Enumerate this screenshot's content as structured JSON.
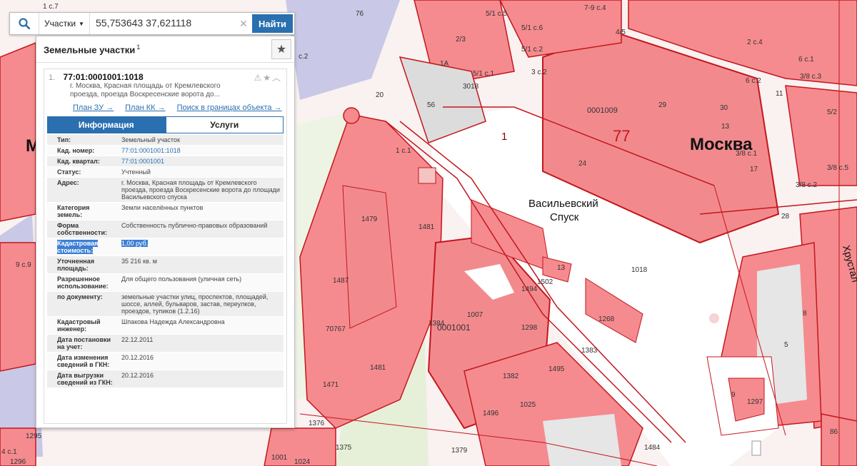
{
  "search": {
    "type_label": "Участки",
    "query": "55,753643 37,621118",
    "find_label": "Найти"
  },
  "panel": {
    "title": "Земельные участки",
    "title_count": "1",
    "result": {
      "index": "1.",
      "cadastral_id": "77:01:0001001:1018",
      "address": "г. Москва, Красная площадь от Кремлевского проезда, проезда Воскресенские ворота до...",
      "links": [
        "План ЗУ →",
        "План КК →",
        "Поиск в границах объекта →"
      ],
      "tabs": [
        "Информация",
        "Услуги"
      ],
      "rows": [
        {
          "label": "Тип:",
          "value": "Земельный участок"
        },
        {
          "label": "Кад. номер:",
          "value": "77:01:0001001:1018"
        },
        {
          "label": "Кад. квартал:",
          "value": "77:01:0001001"
        },
        {
          "label": "Статус:",
          "value": "Учтенный"
        },
        {
          "label": "Адрес:",
          "value": "г. Москва, Красная площадь от Кремлевского проезда, проезда Воскресенские ворота до площади Васильевского спуска"
        },
        {
          "label": "Категория земель:",
          "value": "Земли населённых пунктов"
        },
        {
          "label": "Форма собственности:",
          "value": "Собственность публично-правовых образований"
        },
        {
          "label": "Кадастровая стоимость:",
          "value": "1,00 руб."
        },
        {
          "label": "Уточненная площадь:",
          "value": "35 216 кв. м"
        },
        {
          "label": "Разрешенное использование:",
          "value": "Для общего пользования (уличная сеть)"
        },
        {
          "label": "по документу:",
          "value": "земельные участки улиц, проспектов, площадей, шоссе, аллей, бульваров, застав, переулков, проездов, тупиков (1.2.16)"
        },
        {
          "label": "Кадастровый инженер:",
          "value": "Шпакова Надежда Александровна"
        },
        {
          "label": "Дата постановки на учет:",
          "value": "22.12.2011"
        },
        {
          "label": "Дата изменения сведений в ГКН:",
          "value": "20.12.2016"
        },
        {
          "label": "Дата выгрузки сведений из ГКН:",
          "value": "20.12.2016"
        }
      ]
    }
  },
  "map": {
    "labels": {
      "moskva": "Москва",
      "m": "М",
      "big77": "77",
      "one": "1",
      "vasilyevsky": "Васильевский",
      "spusk": "Спуск",
      "khrustal": "Хрустал",
      "q0001009": "0001009",
      "q0001001": "0001001",
      "n1018": "1018",
      "n1481": "1481",
      "n1487": "1487",
      "n1007": "1007",
      "n1298": "1298",
      "n1297": "1297",
      "n1376": "1376",
      "n1375": "1375",
      "n1379": "1379",
      "n1484": "1484",
      "n1471": "1471",
      "n3018": "3018",
      "n1025": "1025",
      "n1496": "1496",
      "n1495": "1495",
      "n1382": "1382",
      "n1384": "1384",
      "n1383": "1383",
      "n1268": "1268",
      "n1502": "1502",
      "n1494": "1494",
      "n1479": "1479",
      "n70767": "70767",
      "n56": "56",
      "n76": "76",
      "n8": "8",
      "n5": "5",
      "n9": "9",
      "n13": "13",
      "n17": "17",
      "n30": "30",
      "n11": "11",
      "n1295": "1295",
      "n1001": "1001",
      "n1024": "1024",
      "n1296": "1296",
      "n86": "86",
      "c7": "1 с.7",
      "c2a": "с.2",
      "c9": "9 с.9",
      "c1": "4 с.1",
      "s52": "5/2",
      "s38c1": "3/8 с.1",
      "s38c2": "3/8 с.2",
      "s38c3": "3/8 с.3",
      "s38c5": "3/8 с.5",
      "s51c5": "5/1 с.5",
      "s51c6": "5/1 с.6",
      "s51c2": "5/1 с.2",
      "s51c1": "5/1 с.1",
      "s45": "4/5",
      "s23": "2/3",
      "s3c2": "3 с.2",
      "s2c4": "2 с.4",
      "s6c1": "6 с.1",
      "s6c2": "6 с.2",
      "s1c1": "1 с.1",
      "s79c4": "7-9 с.4",
      "s1a": "1А",
      "s20": "20",
      "s29": "29",
      "s28": "28",
      "s24": "24"
    }
  }
}
